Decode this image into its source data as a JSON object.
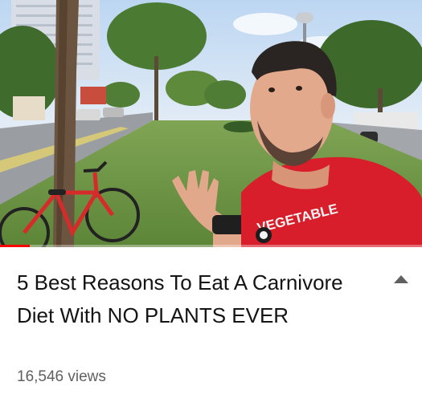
{
  "video": {
    "title": "5 Best Reasons To Eat A Carnivore Diet With NO PLANTS EVER",
    "views": "16,546 views",
    "progress_fraction": 0.07,
    "shirt_text": "VEGETABLE"
  },
  "colors": {
    "progress": "#ff0000",
    "shirt": "#d81e2a",
    "title_text": "#141414",
    "views_text": "#606060"
  },
  "icons": {
    "expand": "chevron-up-icon"
  }
}
